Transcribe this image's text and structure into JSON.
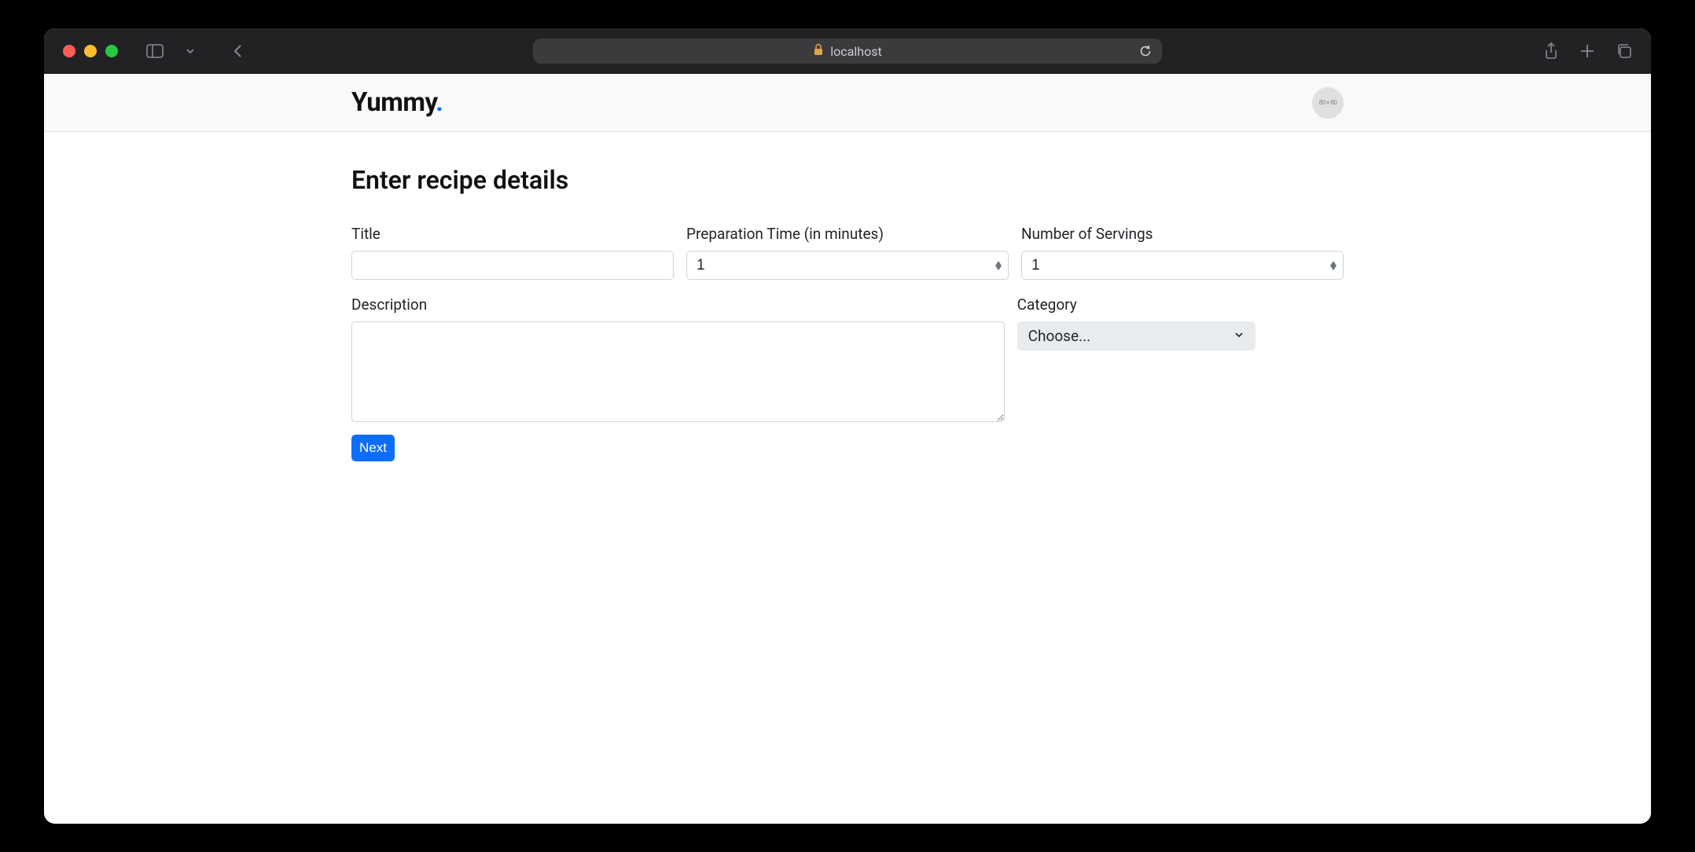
{
  "browser": {
    "url_label": "localhost"
  },
  "header": {
    "brand_text": "Yummy",
    "brand_suffix": ".",
    "avatar_placeholder": "80 × 80"
  },
  "page": {
    "title": "Enter recipe details"
  },
  "form": {
    "title": {
      "label": "Title",
      "value": ""
    },
    "prep_time": {
      "label": "Preparation Time (in minutes)",
      "value": "1"
    },
    "servings": {
      "label": "Number of Servings",
      "value": "1"
    },
    "description": {
      "label": "Description",
      "value": ""
    },
    "category": {
      "label": "Category",
      "placeholder": "Choose..."
    },
    "next_button": "Next"
  }
}
